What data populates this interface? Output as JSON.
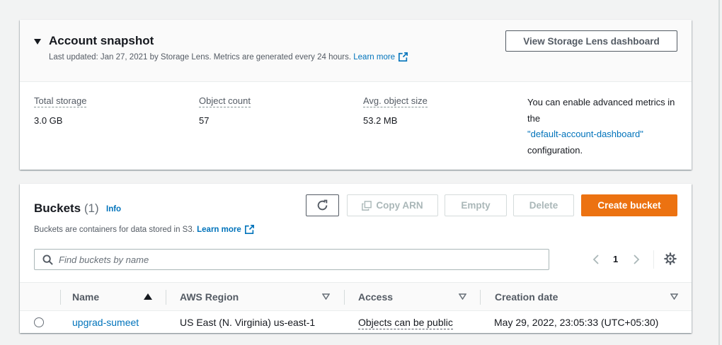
{
  "snapshot": {
    "title": "Account snapshot",
    "subtitle": "Last updated: Jan 27, 2021 by Storage Lens. Metrics are generated every 24 hours.",
    "learn_more": "Learn more",
    "view_lens_button": "View Storage Lens dashboard",
    "metrics": [
      {
        "label": "Total storage",
        "value": "3.0 GB"
      },
      {
        "label": "Object count",
        "value": "57"
      },
      {
        "label": "Avg. object size",
        "value": "53.2 MB"
      }
    ],
    "advanced_text_1": "You can enable advanced metrics in the",
    "advanced_link": "\"default-account-dashboard\"",
    "advanced_text_2": "configuration."
  },
  "buckets": {
    "title": "Buckets",
    "count": "(1)",
    "info": "Info",
    "description": "Buckets are containers for data stored in S3.",
    "learn_more": "Learn more",
    "buttons": {
      "copy_arn": "Copy ARN",
      "empty": "Empty",
      "delete": "Delete",
      "create": "Create bucket"
    },
    "search_placeholder": "Find buckets by name",
    "page": "1",
    "columns": [
      "Name",
      "AWS Region",
      "Access",
      "Creation date"
    ],
    "rows": [
      {
        "name": "upgrad-sumeet",
        "region": "US East (N. Virginia) us-east-1",
        "access": "Objects can be public",
        "created": "May 29, 2022, 23:05:33 (UTC+05:30)"
      }
    ]
  },
  "colors": {
    "accent_orange": "#ec7211",
    "link_blue": "#0073bb"
  },
  "icons": [
    "caret-down-icon",
    "external-link-icon",
    "refresh-icon",
    "copy-icon",
    "search-icon",
    "chevron-left-icon",
    "chevron-right-icon",
    "settings-gear-icon",
    "sort-ascending-icon",
    "sort-descending-icon"
  ]
}
